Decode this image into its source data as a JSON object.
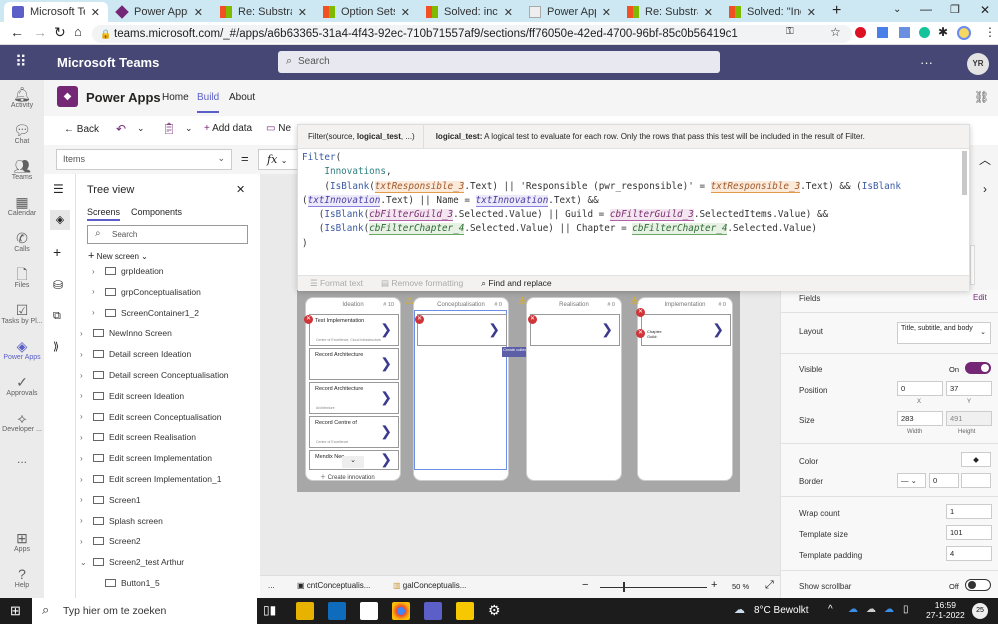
{
  "browser": {
    "tabs": [
      {
        "label": "Microsoft Teams",
        "active": true
      },
      {
        "label": "Power Apps | Solu"
      },
      {
        "label": "Re: Substracting d"
      },
      {
        "label": "Option Sets and N"
      },
      {
        "label": "Solved: incompat"
      },
      {
        "label": "Power Apps Guid"
      },
      {
        "label": "Re: Substracting d"
      },
      {
        "label": "Solved: \"Incompa"
      }
    ],
    "new_tab": "+",
    "url": "teams.microsoft.com/_#/apps/a6b63365-31a4-4f43-92ec-710b71557af9/sections/ff76050e-42ed-4700-96bf-85c0b56419c1"
  },
  "teams": {
    "title": "Microsoft Teams",
    "search_placeholder": "Search",
    "avatar": "YR",
    "rail": [
      {
        "label": "Activity",
        "icon": "bell-icon"
      },
      {
        "label": "Chat",
        "icon": "chat-icon"
      },
      {
        "label": "Teams",
        "icon": "teams-icon"
      },
      {
        "label": "Calendar",
        "icon": "calendar-icon"
      },
      {
        "label": "Calls",
        "icon": "phone-icon"
      },
      {
        "label": "Files",
        "icon": "file-icon"
      },
      {
        "label": "Tasks by Pl...",
        "icon": "tasks-icon"
      },
      {
        "label": "Power Apps",
        "icon": "powerapps-icon",
        "active": true
      },
      {
        "label": "Approvals",
        "icon": "approvals-icon"
      },
      {
        "label": "Developer ...",
        "icon": "developer-icon"
      },
      {
        "label": "...",
        "icon": "more-icon"
      },
      {
        "label": "Apps",
        "icon": "apps-icon"
      },
      {
        "label": "Help",
        "icon": "help-icon"
      }
    ]
  },
  "powerapps": {
    "title": "Power Apps",
    "nav": [
      "Home",
      "Build",
      "About"
    ],
    "active_nav": "Build",
    "toolbar": {
      "back": "Back",
      "add_data": "Add data",
      "new_screen": "Ne"
    },
    "property": "Items",
    "fx": "fx"
  },
  "tree": {
    "title": "Tree view",
    "tabs": [
      "Screens",
      "Components"
    ],
    "search_placeholder": "Search",
    "new_screen": "New screen",
    "items": [
      {
        "label": "grpIdeation",
        "indent": 2,
        "type": "group"
      },
      {
        "label": "grpConceptualisation",
        "indent": 2,
        "type": "group"
      },
      {
        "label": "ScreenContainer1_2",
        "indent": 2,
        "type": "container"
      },
      {
        "label": "NewInno Screen",
        "indent": 1,
        "type": "screen"
      },
      {
        "label": "Detail screen Ideation",
        "indent": 1,
        "type": "screen"
      },
      {
        "label": "Detail screen Conceptualisation",
        "indent": 1,
        "type": "screen"
      },
      {
        "label": "Edit screen Ideation",
        "indent": 1,
        "type": "screen"
      },
      {
        "label": "Edit screen Conceptualisation",
        "indent": 1,
        "type": "screen"
      },
      {
        "label": "Edit screen Realisation",
        "indent": 1,
        "type": "screen"
      },
      {
        "label": "Edit screen Implementation",
        "indent": 1,
        "type": "screen"
      },
      {
        "label": "Edit screen Implementation_1",
        "indent": 1,
        "type": "screen"
      },
      {
        "label": "Screen1",
        "indent": 1,
        "type": "screen"
      },
      {
        "label": "Splash screen",
        "indent": 1,
        "type": "screen"
      },
      {
        "label": "Screen2",
        "indent": 1,
        "type": "screen"
      },
      {
        "label": "Screen2_test Arthur",
        "indent": 1,
        "type": "screen",
        "expanded": true
      },
      {
        "label": "Button1_5",
        "indent": 2,
        "type": "button"
      }
    ]
  },
  "formula": {
    "signature": "Filter(source, ",
    "signature_bold": "logical_test",
    "signature_end": ", ...)",
    "param": "logical_test:",
    "param_desc": "A logical test to evaluate for each row. Only the rows that pass this test will be included in the result of Filter.",
    "format_text": "Format text",
    "remove_formatting": "Remove formatting",
    "find_replace": "Find and replace"
  },
  "canvas": {
    "columns": [
      {
        "title": "Ideation",
        "count": "# 10"
      },
      {
        "title": "Conceptualisation",
        "count": "# 0"
      },
      {
        "title": "Realisation",
        "count": "# 0"
      },
      {
        "title": "Implementation",
        "count": "# 0"
      }
    ],
    "ideation_cards": [
      {
        "title": "Test Implementation",
        "sub": "Centre of Excellence, Cloud Infrastructure"
      },
      {
        "title": "Record Architecture",
        "sub": ""
      },
      {
        "title": "Record Architecture",
        "sub": "Architecture"
      },
      {
        "title": "Record Centre of",
        "sub": "Centre of Excellence"
      },
      {
        "title": "Mendix Neo",
        "sub": ""
      }
    ],
    "create_innovation": "Create innovation",
    "tooltip": "Create collection",
    "impl_card": {
      "line1": "Chapter:",
      "line2": "Guild:"
    }
  },
  "properties": {
    "fields": "Fields",
    "edit": "Edit",
    "layout": "Layout",
    "layout_value": "Title, subtitle, and body",
    "visible": "Visible",
    "visible_state": "On",
    "position": "Position",
    "x": "0",
    "y": "37",
    "x_label": "X",
    "y_label": "Y",
    "size": "Size",
    "width": "283",
    "height": "491",
    "width_label": "Width",
    "height_label": "Height",
    "color": "Color",
    "border": "Border",
    "border_width": "0",
    "wrap_count": "Wrap count",
    "wrap_count_value": "1",
    "template_size": "Template size",
    "template_size_value": "101",
    "template_padding": "Template padding",
    "template_padding_value": "4",
    "show_scrollbar": "Show scrollbar",
    "show_scrollbar_state": "Off",
    "accent": "#742774"
  },
  "status": {
    "more": "...",
    "crumb1": "cntConceptualis...",
    "crumb2": "galConceptualis...",
    "zoom": "50",
    "zoom_unit": "%"
  },
  "taskbar": {
    "search": "Typ hier om te zoeken",
    "weather": "8°C  Bewolkt",
    "time": "16:59",
    "date": "27-1-2022",
    "notifications": "25"
  }
}
